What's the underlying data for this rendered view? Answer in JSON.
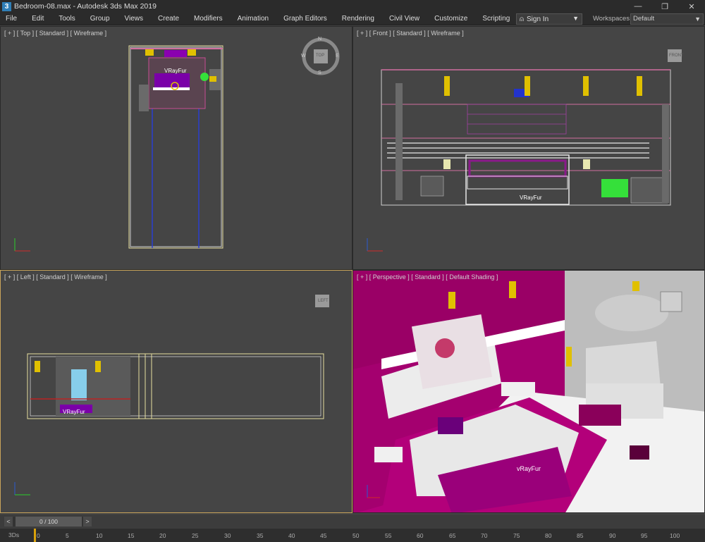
{
  "window": {
    "title": "Bedroom-08.max - Autodesk 3ds Max 2019",
    "app_icon": "3",
    "controls": [
      "—",
      "❐",
      "✕"
    ]
  },
  "menu": {
    "items": [
      "File",
      "Edit",
      "Tools",
      "Group",
      "Views",
      "Create",
      "Modifiers",
      "Animation",
      "Graph Editors",
      "Rendering",
      "Civil View",
      "Customize",
      "Scripting"
    ],
    "signin_label": "Sign In",
    "workspaces_label": "Workspaces:",
    "workspaces_value": "Default"
  },
  "viewports": {
    "top": {
      "label": "[ + ] [ Top ] [ Standard ] [ Wireframe ]",
      "viewcube": {
        "n": "N",
        "s": "S",
        "e": "E",
        "w": "W",
        "face": "TOP"
      },
      "object_label": "VRayFur"
    },
    "front": {
      "label": "[ + ] [ Front ] [ Standard ] [ Wireframe ]",
      "viewcube_face": "FRONT",
      "object_label": "VRayFur"
    },
    "left": {
      "label": "[ + ] [ Left ] [ Standard ] [ Wireframe ]",
      "viewcube_face": "LEFT",
      "object_label": "VRayFur"
    },
    "perspective": {
      "label": "[ + ] [ Perspective ] [ Standard ] [ Default Shading ]",
      "object_label": "vRayFur"
    }
  },
  "timeline": {
    "frame_display": "0 / 100",
    "prev_btn": "<",
    "next_btn": ">",
    "ticks": [
      "0",
      "5",
      "10",
      "15",
      "20",
      "25",
      "30",
      "35",
      "40",
      "45",
      "50",
      "55",
      "60",
      "65",
      "70",
      "75",
      "80",
      "85",
      "90",
      "95",
      "100"
    ],
    "badge": "3Ds"
  },
  "colors": {
    "accent_magenta": "#b3007a",
    "active_border": "#c9a45a",
    "wire_white": "#e8e8e8",
    "wire_pink": "#d16fa0"
  }
}
